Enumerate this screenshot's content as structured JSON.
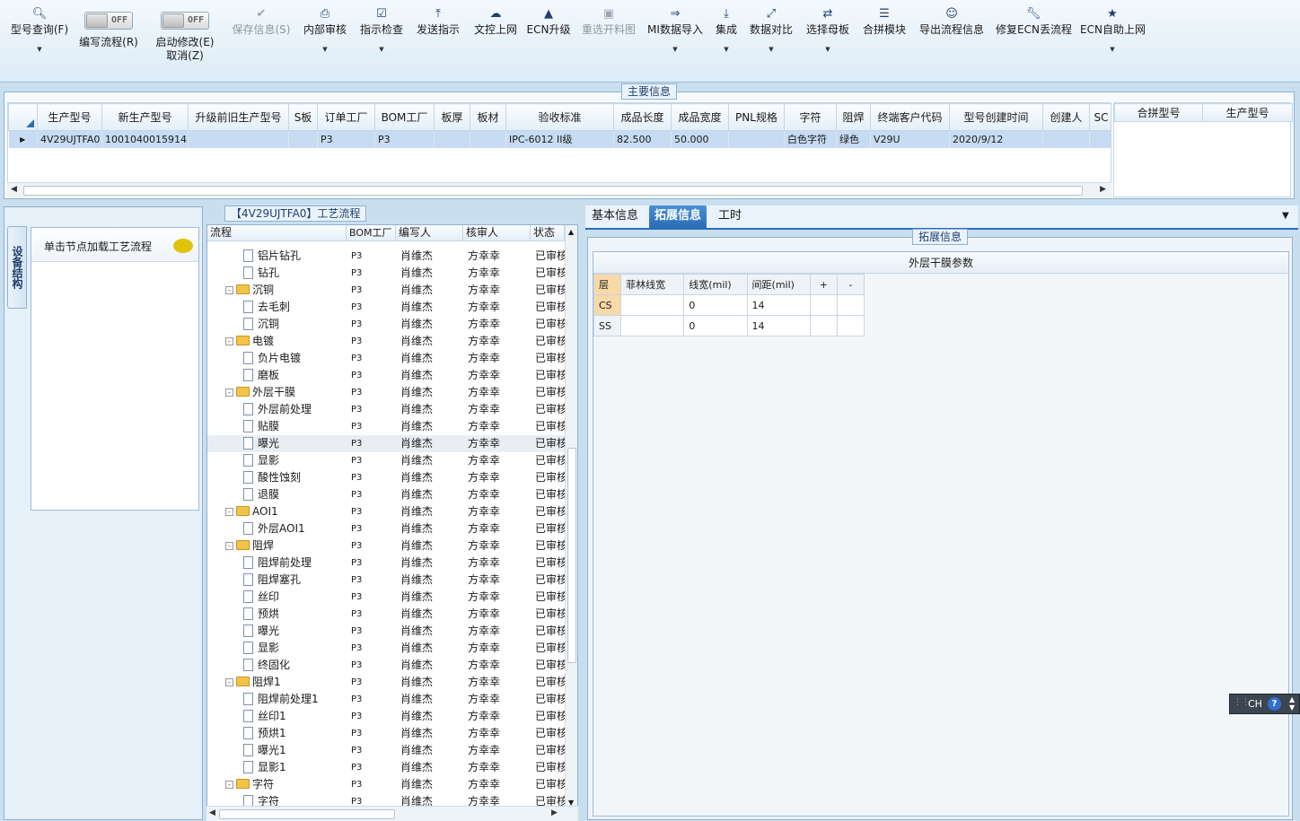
{
  "toolbar": {
    "buttons": [
      {
        "icon": "search-icon",
        "label": "型号查询(F)",
        "caret": true
      },
      {
        "icon": "toggle",
        "label": "编写流程(R)"
      },
      {
        "icon": "toggle",
        "label": "启动修改(E)",
        "label2": "取消(Z)"
      },
      {
        "icon": "check-icon",
        "label": "保存信息(S)",
        "disabled": true
      },
      {
        "icon": "printer-icon",
        "label": "内部审核",
        "caret": true
      },
      {
        "icon": "checkbox-icon",
        "label": "指示检查",
        "caret": true
      },
      {
        "icon": "upload-icon",
        "label": "发送指示"
      },
      {
        "icon": "cloud-upload-icon",
        "label": "文控上网"
      },
      {
        "icon": "ecn-icon",
        "label": "ECN升级"
      },
      {
        "icon": "image-icon",
        "label": "重选开料图",
        "disabled": true
      },
      {
        "icon": "import-icon",
        "label": "MI数据导入",
        "caret": true
      },
      {
        "icon": "integrate-icon",
        "label": "集成",
        "caret": true
      },
      {
        "icon": "compare-icon",
        "label": "数据对比",
        "caret": true
      },
      {
        "icon": "shuffle-icon",
        "label": "选择母板",
        "caret": true
      },
      {
        "icon": "list-icon",
        "label": "合拼模块"
      },
      {
        "icon": "smile-icon",
        "label": "导出流程信息"
      },
      {
        "icon": "wrench-icon",
        "label": "修复ECN丢流程"
      },
      {
        "icon": "star-icon",
        "label": "ECN自助上网",
        "caret": true
      }
    ],
    "toggle_text": "OFF"
  },
  "main_info": {
    "title": "主要信息",
    "columns": [
      "生产型号",
      "新生产型号",
      "升级前旧生产型号",
      "S板",
      "订单工厂",
      "BOM工厂",
      "板厚",
      "板材",
      "验收标准",
      "成品长度",
      "成品宽度",
      "PNL规格",
      "字符",
      "阻焊",
      "终端客户代码",
      "型号创建时间",
      "创建人",
      "SC"
    ],
    "row": [
      "4V29UJTFA0",
      "10010400159142",
      "",
      "",
      "P3",
      "P3",
      "",
      "",
      "IPC-6012 II级",
      "82.500",
      "50.000",
      "",
      "白色字符",
      "绿色",
      "V29U",
      "2020/9/12",
      "",
      ""
    ],
    "side_columns": [
      "合拼型号",
      "生产型号"
    ]
  },
  "left_panel": {
    "vertical_tab": "设备结构",
    "hint": "单击节点加载工艺流程"
  },
  "process": {
    "title": "【4V29UJTFA0】工艺流程",
    "columns": [
      "流程",
      "BOM工厂",
      "编写人",
      "核审人",
      "状态"
    ],
    "rows": [
      {
        "level": 1,
        "name": "铝片钻孔",
        "bom": "P3",
        "writer": "肖维杰",
        "reviewer": "方幸幸",
        "status": "已审核"
      },
      {
        "level": 1,
        "name": "钻孔",
        "bom": "P3",
        "writer": "肖维杰",
        "reviewer": "方幸幸",
        "status": "已审核"
      },
      {
        "level": 0,
        "name": "沉铜",
        "bom": "P3",
        "writer": "肖维杰",
        "reviewer": "方幸幸",
        "status": "已审核"
      },
      {
        "level": 1,
        "name": "去毛刺",
        "bom": "P3",
        "writer": "肖维杰",
        "reviewer": "方幸幸",
        "status": "已审核"
      },
      {
        "level": 1,
        "name": "沉铜",
        "bom": "P3",
        "writer": "肖维杰",
        "reviewer": "方幸幸",
        "status": "已审核"
      },
      {
        "level": 0,
        "name": "电镀",
        "bom": "P3",
        "writer": "肖维杰",
        "reviewer": "方幸幸",
        "status": "已审核"
      },
      {
        "level": 1,
        "name": "负片电镀",
        "bom": "P3",
        "writer": "肖维杰",
        "reviewer": "方幸幸",
        "status": "已审核"
      },
      {
        "level": 1,
        "name": "磨板",
        "bom": "P3",
        "writer": "肖维杰",
        "reviewer": "方幸幸",
        "status": "已审核"
      },
      {
        "level": 0,
        "name": "外层干膜",
        "bom": "P3",
        "writer": "肖维杰",
        "reviewer": "方幸幸",
        "status": "已审核"
      },
      {
        "level": 1,
        "name": "外层前处理",
        "bom": "P3",
        "writer": "肖维杰",
        "reviewer": "方幸幸",
        "status": "已审核"
      },
      {
        "level": 1,
        "name": "贴膜",
        "bom": "P3",
        "writer": "肖维杰",
        "reviewer": "方幸幸",
        "status": "已审核"
      },
      {
        "level": 1,
        "name": "曝光",
        "bom": "P3",
        "writer": "肖维杰",
        "reviewer": "方幸幸",
        "status": "已审核",
        "selected": true
      },
      {
        "level": 1,
        "name": "显影",
        "bom": "P3",
        "writer": "肖维杰",
        "reviewer": "方幸幸",
        "status": "已审核"
      },
      {
        "level": 1,
        "name": "酸性蚀刻",
        "bom": "P3",
        "writer": "肖维杰",
        "reviewer": "方幸幸",
        "status": "已审核"
      },
      {
        "level": 1,
        "name": "退膜",
        "bom": "P3",
        "writer": "肖维杰",
        "reviewer": "方幸幸",
        "status": "已审核"
      },
      {
        "level": 0,
        "name": "AOI1",
        "bom": "P3",
        "writer": "肖维杰",
        "reviewer": "方幸幸",
        "status": "已审核"
      },
      {
        "level": 1,
        "name": "外层AOI1",
        "bom": "P3",
        "writer": "肖维杰",
        "reviewer": "方幸幸",
        "status": "已审核"
      },
      {
        "level": 0,
        "name": "阻焊",
        "bom": "P3",
        "writer": "肖维杰",
        "reviewer": "方幸幸",
        "status": "已审核"
      },
      {
        "level": 1,
        "name": "阻焊前处理",
        "bom": "P3",
        "writer": "肖维杰",
        "reviewer": "方幸幸",
        "status": "已审核"
      },
      {
        "level": 1,
        "name": "阻焊塞孔",
        "bom": "P3",
        "writer": "肖维杰",
        "reviewer": "方幸幸",
        "status": "已审核"
      },
      {
        "level": 1,
        "name": "丝印",
        "bom": "P3",
        "writer": "肖维杰",
        "reviewer": "方幸幸",
        "status": "已审核"
      },
      {
        "level": 1,
        "name": "预烘",
        "bom": "P3",
        "writer": "肖维杰",
        "reviewer": "方幸幸",
        "status": "已审核"
      },
      {
        "level": 1,
        "name": "曝光",
        "bom": "P3",
        "writer": "肖维杰",
        "reviewer": "方幸幸",
        "status": "已审核"
      },
      {
        "level": 1,
        "name": "显影",
        "bom": "P3",
        "writer": "肖维杰",
        "reviewer": "方幸幸",
        "status": "已审核"
      },
      {
        "level": 1,
        "name": "终固化",
        "bom": "P3",
        "writer": "肖维杰",
        "reviewer": "方幸幸",
        "status": "已审核"
      },
      {
        "level": 0,
        "name": "阻焊1",
        "bom": "P3",
        "writer": "肖维杰",
        "reviewer": "方幸幸",
        "status": "已审核"
      },
      {
        "level": 1,
        "name": "阻焊前处理1",
        "bom": "P3",
        "writer": "肖维杰",
        "reviewer": "方幸幸",
        "status": "已审核"
      },
      {
        "level": 1,
        "name": "丝印1",
        "bom": "P3",
        "writer": "肖维杰",
        "reviewer": "方幸幸",
        "status": "已审核"
      },
      {
        "level": 1,
        "name": "预烘1",
        "bom": "P3",
        "writer": "肖维杰",
        "reviewer": "方幸幸",
        "status": "已审核"
      },
      {
        "level": 1,
        "name": "曝光1",
        "bom": "P3",
        "writer": "肖维杰",
        "reviewer": "方幸幸",
        "status": "已审核"
      },
      {
        "level": 1,
        "name": "显影1",
        "bom": "P3",
        "writer": "肖维杰",
        "reviewer": "方幸幸",
        "status": "已审核"
      },
      {
        "level": 0,
        "name": "字符",
        "bom": "P3",
        "writer": "肖维杰",
        "reviewer": "方幸幸",
        "status": "已审核"
      },
      {
        "level": 1,
        "name": "字符",
        "bom": "P3",
        "writer": "肖维杰",
        "reviewer": "方幸幸",
        "status": "已审核"
      }
    ]
  },
  "right_panel": {
    "tabs": [
      "基本信息",
      "拓展信息",
      "工时"
    ],
    "active_tab": 1,
    "group_title": "拓展信息",
    "table_title": "外层干膜参数",
    "columns": [
      "层",
      "菲林线宽",
      "线宽(mil)",
      "间距(mil)",
      "+",
      "-"
    ],
    "rows": [
      [
        "CS",
        "",
        "0",
        "14",
        "",
        ""
      ],
      [
        "SS",
        "",
        "0",
        "14",
        "",
        ""
      ]
    ]
  },
  "ime": {
    "label": "CH",
    "help": "?"
  },
  "colors": {
    "accent": "#2a6db5",
    "selected_row": "#c7dcf2",
    "layer_header": "#f8d9a8"
  }
}
